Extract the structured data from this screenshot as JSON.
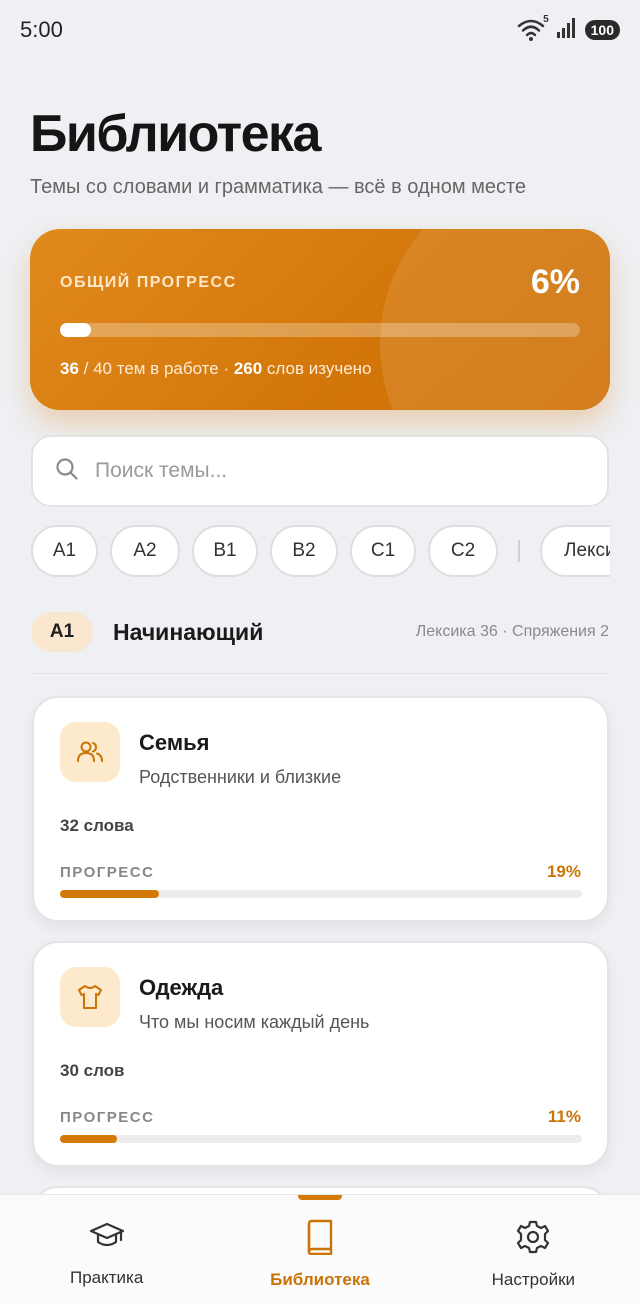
{
  "status": {
    "time": "5:00",
    "battery": "100",
    "signal_badge": "5"
  },
  "header": {
    "title": "Библиотека",
    "subtitle": "Темы со словами и грамматика — всё в одном месте"
  },
  "progress": {
    "label": "ОБЩИЙ ПРОГРЕСС",
    "percent_text": "6%",
    "fraction": 0.06,
    "topics_done": "36",
    "topics_rest": " / 40 тем в работе · ",
    "words": "260",
    "words_rest": " слов изучено"
  },
  "search": {
    "placeholder": "Поиск темы..."
  },
  "chips": {
    "a1": "A1",
    "a2": "A2",
    "b1": "B1",
    "b2": "B2",
    "c1": "C1",
    "c2": "C2",
    "lexicon": "Лексика"
  },
  "level": {
    "badge": "A1",
    "name": "Начинающий",
    "stats": "Лексика 36 · Спряжения 2"
  },
  "topics": [
    {
      "title": "Семья",
      "description": "Родственники и близкие",
      "words": "32 слова",
      "progress_label": "ПРОГРЕСС",
      "progress_text": "19%",
      "progress": 0.19,
      "icon": "people-icon"
    },
    {
      "title": "Одежда",
      "description": "Что мы носим каждый день",
      "words": "30 слов",
      "progress_label": "ПРОГРЕСС",
      "progress_text": "11%",
      "progress": 0.11,
      "icon": "tshirt-icon"
    }
  ],
  "nav": {
    "practice": "Практика",
    "library": "Библиотека",
    "settings": "Настройки",
    "active": "library"
  },
  "colors": {
    "accent": "#d47908",
    "accent_text": "#c97406",
    "background": "#eef0f3"
  }
}
